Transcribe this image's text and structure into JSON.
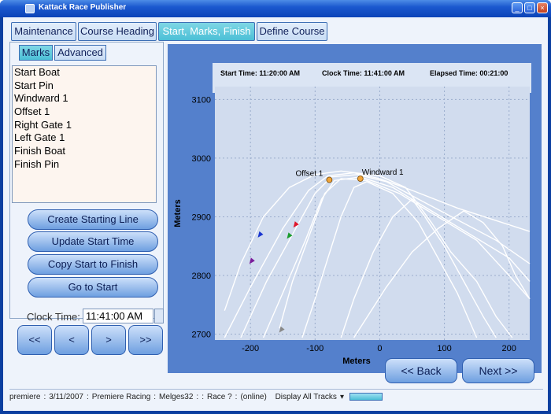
{
  "window": {
    "title": "Kattack Race Publisher"
  },
  "tabs": [
    {
      "label": "Maintenance",
      "active": false
    },
    {
      "label": "Course Heading",
      "active": false
    },
    {
      "label": "Start, Marks, Finish",
      "active": true
    },
    {
      "label": "Define Course",
      "active": false
    }
  ],
  "subtabs": [
    {
      "label": "Marks",
      "active": true
    },
    {
      "label": "Advanced",
      "active": false
    }
  ],
  "marks": [
    "Start Boat",
    "Start Pin",
    "Windward 1",
    "Offset 1",
    "Right Gate 1",
    "Left Gate 1",
    "Finish Boat",
    "Finish Pin"
  ],
  "actions": {
    "create_start_line": "Create Starting Line",
    "update_start_time": "Update Start Time",
    "copy_start_finish": "Copy Start to Finish",
    "go_to_start": "Go to Start"
  },
  "clock": {
    "label": "Clock Time:",
    "value": "11:41:00 AM"
  },
  "nav": {
    "first": "<<",
    "prev": "<",
    "next": ">",
    "last": ">>"
  },
  "chart_header": {
    "start_time": "Start Time: 11:20:00 AM",
    "clock_time": "Clock Time: 11:41:00 AM",
    "elapsed_time": "Elapsed Time: 00:21:00"
  },
  "chart_data": {
    "type": "scatter",
    "xlabel": "Meters",
    "ylabel": "Meters",
    "xlim": [
      -255,
      232
    ],
    "ylim": [
      2690,
      3122
    ],
    "x_ticks": [
      -200,
      -100,
      0,
      100,
      200
    ],
    "y_ticks": [
      2700,
      2800,
      2900,
      3000,
      3100
    ],
    "grid": true,
    "marks": [
      {
        "label": "Offset 1",
        "x": -78,
        "y": 2963
      },
      {
        "label": "Windward 1",
        "x": -30,
        "y": 2965
      }
    ],
    "boats": [
      {
        "x": -130,
        "y": 2887,
        "color": "#e0162b"
      },
      {
        "x": -140,
        "y": 2868,
        "color": "#1b9c2e"
      },
      {
        "x": -185,
        "y": 2870,
        "color": "#1a36d0"
      },
      {
        "x": -198,
        "y": 2825,
        "color": "#7a1b9a"
      },
      {
        "x": -152,
        "y": 2708,
        "color": "#888888"
      }
    ],
    "tracks": [
      [
        [
          -240,
          2694
        ],
        [
          -200,
          2780
        ],
        [
          -150,
          2880
        ],
        [
          -110,
          2945
        ],
        [
          -80,
          2970
        ],
        [
          -40,
          2975
        ],
        [
          0,
          2965
        ],
        [
          50,
          2945
        ],
        [
          120,
          2915
        ],
        [
          190,
          2890
        ],
        [
          232,
          2875
        ]
      ],
      [
        [
          -215,
          2694
        ],
        [
          -175,
          2790
        ],
        [
          -135,
          2870
        ],
        [
          -100,
          2940
        ],
        [
          -75,
          2968
        ],
        [
          -35,
          2972
        ],
        [
          10,
          2960
        ],
        [
          60,
          2930
        ],
        [
          120,
          2895
        ],
        [
          180,
          2860
        ],
        [
          232,
          2820
        ]
      ],
      [
        [
          -180,
          2694
        ],
        [
          -150,
          2770
        ],
        [
          -115,
          2860
        ],
        [
          -90,
          2930
        ],
        [
          -70,
          2962
        ],
        [
          -30,
          2968
        ],
        [
          20,
          2950
        ],
        [
          80,
          2910
        ],
        [
          140,
          2870
        ],
        [
          200,
          2830
        ],
        [
          232,
          2790
        ]
      ],
      [
        [
          -155,
          2710
        ],
        [
          -135,
          2790
        ],
        [
          -105,
          2880
        ],
        [
          -85,
          2940
        ],
        [
          -60,
          2965
        ],
        [
          -20,
          2962
        ],
        [
          30,
          2940
        ],
        [
          90,
          2900
        ],
        [
          150,
          2860
        ],
        [
          200,
          2800
        ],
        [
          232,
          2760
        ]
      ],
      [
        [
          -240,
          2740
        ],
        [
          -215,
          2820
        ],
        [
          -180,
          2900
        ],
        [
          -140,
          2950
        ],
        [
          -100,
          2972
        ],
        [
          -60,
          2978
        ],
        [
          0,
          2970
        ],
        [
          40,
          2950
        ],
        [
          80,
          2890
        ],
        [
          110,
          2840
        ],
        [
          150,
          2790
        ],
        [
          180,
          2730
        ],
        [
          205,
          2694
        ]
      ],
      [
        [
          -120,
          2694
        ],
        [
          -100,
          2760
        ],
        [
          -80,
          2830
        ],
        [
          -60,
          2900
        ],
        [
          -40,
          2950
        ],
        [
          -20,
          2960
        ],
        [
          20,
          2940
        ],
        [
          60,
          2890
        ],
        [
          90,
          2830
        ],
        [
          120,
          2770
        ],
        [
          150,
          2694
        ]
      ],
      [
        [
          -60,
          2694
        ],
        [
          -40,
          2760
        ],
        [
          -10,
          2840
        ],
        [
          20,
          2900
        ],
        [
          50,
          2930
        ],
        [
          70,
          2900
        ],
        [
          100,
          2850
        ],
        [
          130,
          2790
        ],
        [
          160,
          2730
        ],
        [
          180,
          2694
        ]
      ],
      [
        [
          -40,
          2694
        ],
        [
          10,
          2780
        ],
        [
          50,
          2840
        ],
        [
          90,
          2880
        ],
        [
          130,
          2910
        ],
        [
          160,
          2890
        ],
        [
          190,
          2850
        ],
        [
          210,
          2800
        ],
        [
          232,
          2760
        ]
      ]
    ]
  },
  "buttons": {
    "back": "<< Back",
    "next": "Next >>"
  },
  "status": {
    "fields": [
      "premiere",
      ":",
      "3/11/2007",
      ":",
      "Premiere Racing",
      ":",
      "Melges32",
      ":",
      ":",
      "Race ?",
      ":",
      "(online)"
    ],
    "display_select": "Display All Tracks",
    "progress": 1.0
  },
  "colors": {
    "accent": "#4bbfd6",
    "panel": "#5480cc",
    "plot_bg": "#dbe5f4",
    "track": "#ffffff",
    "mark": "#f0a43a"
  }
}
